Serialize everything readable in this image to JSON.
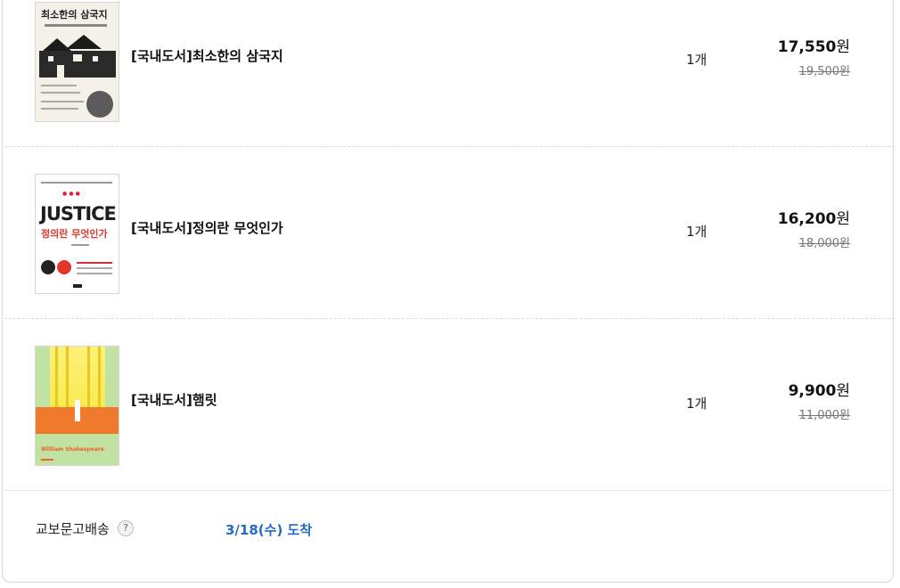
{
  "items": [
    {
      "title": "[국내도서]최소한의 삼국지",
      "quantity": "1개",
      "sale_price": "17,550",
      "original_price": "19,500원",
      "cover": {
        "title": "최소한의 삼국지"
      }
    },
    {
      "title": "[국내도서]정의란 무엇인가",
      "quantity": "1개",
      "sale_price": "16,200",
      "original_price": "18,000원",
      "cover": {
        "title_en": "JUSTICE",
        "title": "정의란 무엇인가"
      }
    },
    {
      "title": "[국내도서]햄릿",
      "quantity": "1개",
      "sale_price": "9,900",
      "original_price": "11,000원",
      "cover": {
        "author": "William Shakespeare"
      }
    }
  ],
  "currency_unit": "원",
  "shipping": {
    "label": "교보문고배송",
    "help_icon": "?",
    "arrival": "3/18(수) 도착"
  },
  "colors": {
    "accent_blue": "#1f6bc6",
    "border": "#d7d7d7"
  }
}
